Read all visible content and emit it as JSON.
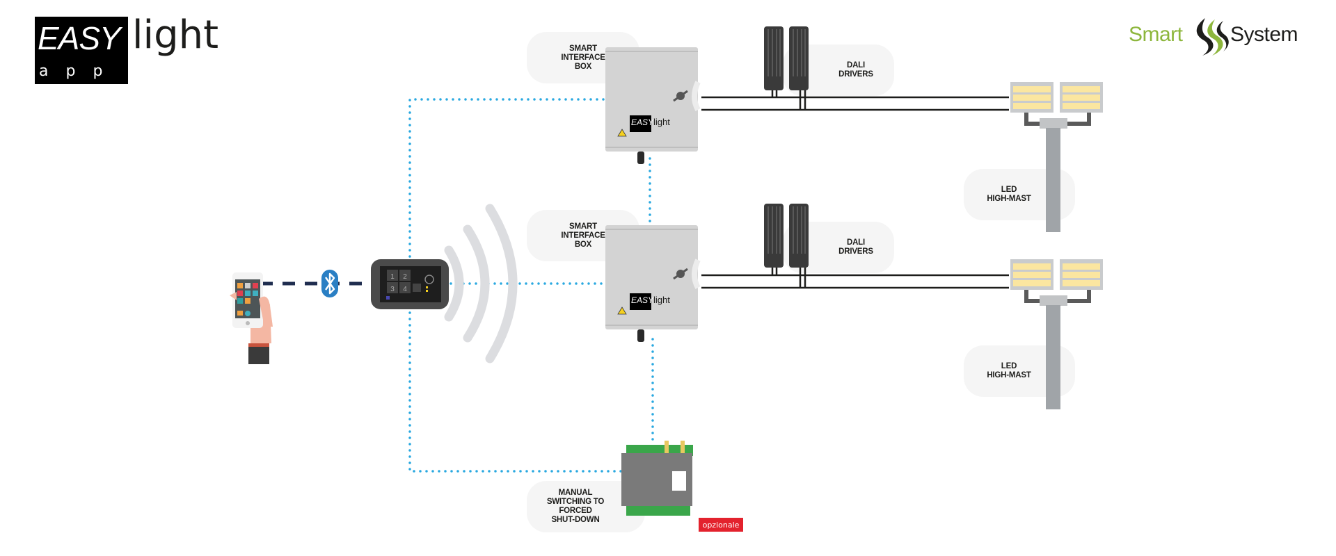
{
  "branding": {
    "app_logo": {
      "easy": "EASY",
      "light": "light",
      "app": "app"
    },
    "company_logo": {
      "smart": "Smart",
      "system": "System"
    }
  },
  "colors": {
    "wireless_dots": "#29a8e0",
    "bluetooth_dashes": "#1f2d4f",
    "bluetooth_badge": "#2a7fc4",
    "cable": "#1d1d1b",
    "label_bg": "#f5f5f5",
    "brand_green": "#8db63c",
    "optional_badge": "#e3222d",
    "led_panel": "#fbe6a0",
    "mast": "#a0a4a8"
  },
  "nodes": {
    "smartphone": {
      "icon": "smartphone-hand-icon"
    },
    "bluetooth": {
      "icon": "bluetooth-icon"
    },
    "gateway": {
      "icon": "wireless-gateway-icon",
      "keys": [
        "1",
        "2",
        "3",
        "4"
      ]
    },
    "interface_box_1": {
      "label": "SMART\nINTERFACE\nBOX",
      "box_logo_easy": "EASY",
      "box_logo_light": "light"
    },
    "interface_box_2": {
      "label": "SMART\nINTERFACE\nBOX",
      "box_logo_easy": "EASY",
      "box_logo_light": "light"
    },
    "dali_drivers_1": {
      "label": "DALI\nDRIVERS"
    },
    "dali_drivers_2": {
      "label": "DALI\nDRIVERS"
    },
    "high_mast_1": {
      "label": "LED\nHIGH-MAST"
    },
    "high_mast_2": {
      "label": "LED\nHIGH-MAST"
    },
    "manual_switch": {
      "label": "MANUAL\nSWITCHING TO\nFORCED\nSHUT-DOWN",
      "badge": "opzionale"
    }
  }
}
